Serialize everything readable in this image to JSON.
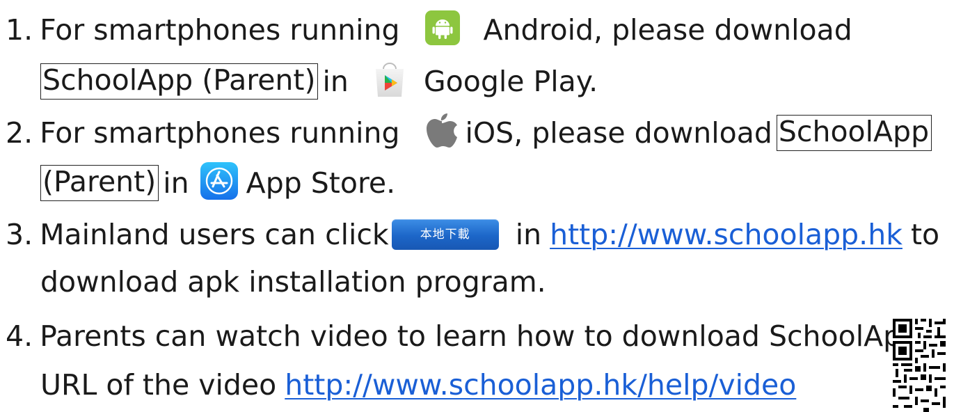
{
  "items": [
    {
      "num": "1.",
      "pre": "For smartphones running",
      "os": "Android, please download",
      "app": "SchoolApp (Parent)",
      "in": "in",
      "store": "Google Play."
    },
    {
      "num": "2.",
      "pre": "For smartphones running",
      "os": "iOS, please download",
      "app_part1": "SchoolApp",
      "app_part2": "(Parent)",
      "in": "in",
      "store": "App Store."
    },
    {
      "num": "3.",
      "pre": "Mainland users can click",
      "button_label": "本地下載",
      "in": "in",
      "link": "http://www.schoolapp.hk",
      "post": "to",
      "line2": "download apk installation program."
    },
    {
      "num": "4.",
      "text": "Parents can watch video to learn how to download SchoolApp",
      "line2_pre": "URL of the video",
      "link": "http://www.schoolapp.hk/help/video"
    }
  ],
  "icons": {
    "android": "android-icon",
    "google_play": "google-play-icon",
    "apple": "apple-icon",
    "app_store": "app-store-icon",
    "qr": "qr-code"
  },
  "colors": {
    "link": "#1a5fd6",
    "android": "#8dc63f",
    "button": "#1c66c8",
    "app_store": "#1a9af0"
  }
}
